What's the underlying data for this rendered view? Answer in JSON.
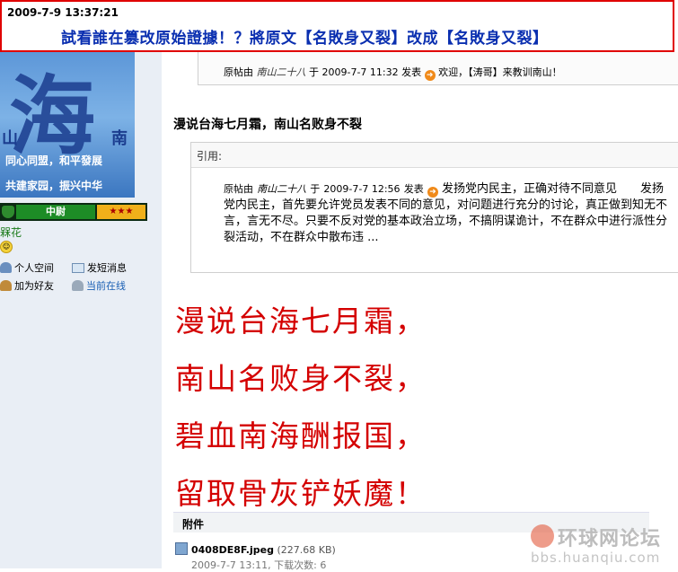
{
  "banner": {
    "timestamp": "2009-7-9 13:37:21",
    "headline": "試看誰在篡改原始證據！？將原文【名敗身又裂】改成【名敗身又裂】"
  },
  "sidebar": {
    "avatar": {
      "big_char": "海",
      "left_char": "山",
      "right_char": "南",
      "slogan1": "同心同盟，和平發展",
      "slogan2": "共建家园，振兴中华"
    },
    "rank_label": "中尉",
    "rank_stars": "★★★",
    "username": "槑花",
    "actions": [
      {
        "label": "个人空间",
        "icon": "user-space-icon"
      },
      {
        "label": "发短消息",
        "icon": "message-icon"
      },
      {
        "label": "加为好友",
        "icon": "add-friend-icon"
      },
      {
        "label": "当前在线",
        "icon": "online-icon"
      }
    ]
  },
  "top_quote": {
    "prefix": "原帖由",
    "author": "南山二十八",
    "mid": "于",
    "datetime": "2009-7-7 11:32",
    "suffix": "发表",
    "text": "欢迎，【涛哥】来教训南山！"
  },
  "post": {
    "title": "漫说台海七月霜，南山名败身不裂"
  },
  "quote": {
    "label": "引用:",
    "prefix": "原帖由",
    "author": "南山二十八",
    "mid": "于",
    "datetime": "2009-7-7 12:56",
    "suffix": "发表",
    "text": "发扬党内民主，正确对待不同意见　　发扬党内民主，首先要允许党员发表不同的意见，对问题进行充分的讨论，真正做到知无不言，言无不尽。只要不反对党的基本政治立场，不搞阴谋诡计，不在群众中进行派性分裂活动，不在群众中散布违 ..."
  },
  "poem": [
    "漫说台海七月霜，",
    "南山名败身不裂，",
    "碧血南海酬报国，",
    "留取骨灰铲妖魔！"
  ],
  "attachments": {
    "label": "附件",
    "file_name": "0408DE8F.jpeg",
    "file_size": "(227.68 KB)",
    "file_meta": "2009-7-7 13:11, 下载次数: 6"
  },
  "watermark": {
    "site_cn": "环球网论坛",
    "url": "bbs.huanqiu.com"
  }
}
